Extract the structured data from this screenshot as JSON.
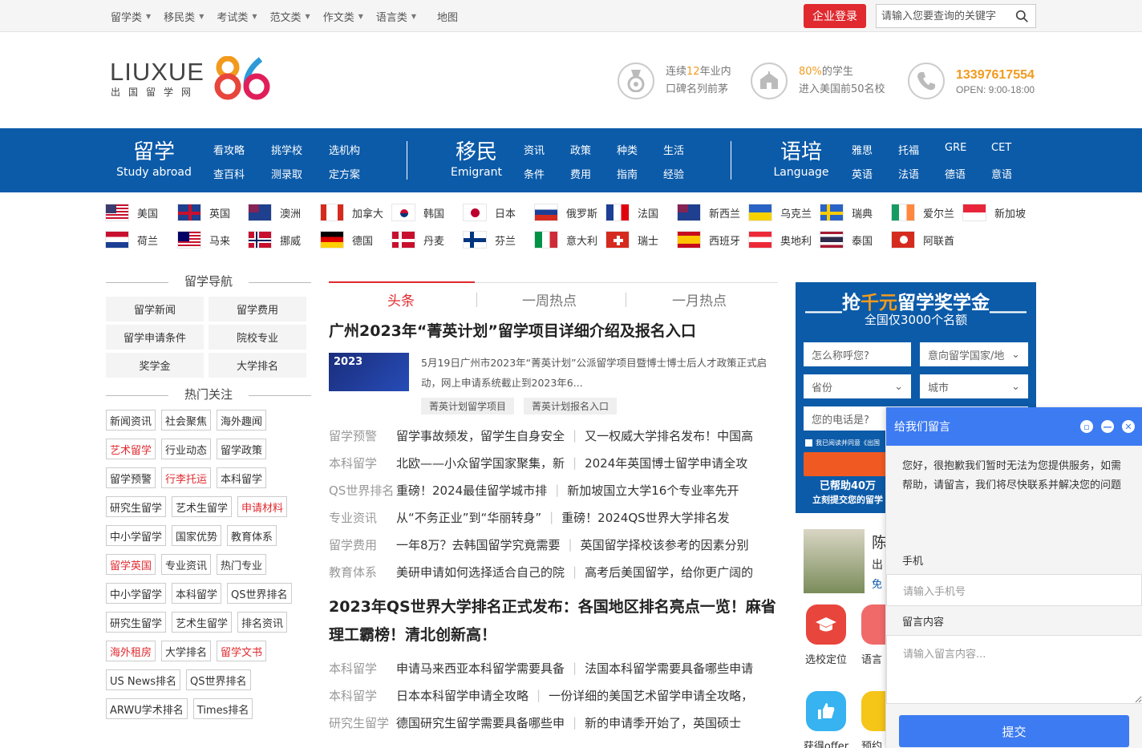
{
  "topnav": {
    "items": [
      "留学类",
      "移民类",
      "考试类",
      "范文类",
      "作文类",
      "语言类"
    ],
    "map": "地图",
    "login_button": "企业登录",
    "search_placeholder": "请输入您要查询的关键字"
  },
  "logo": {
    "word": "LIUXUE",
    "num": "86",
    "sub": "出国留学网"
  },
  "features": {
    "f1": {
      "a": "连续",
      "b": "12",
      "c": "年业内",
      "line2": "口碑名列前茅",
      "icon": "medal-icon"
    },
    "f2": {
      "b": "80%",
      "c": "的学生",
      "line2": "进入美国前50名校",
      "icon": "school-icon"
    },
    "f3": {
      "phone": "13397617554",
      "hours": "OPEN: 9:00-18:00",
      "icon": "phone-icon"
    }
  },
  "mainnav": {
    "study": {
      "cn": "留学",
      "en": "Study abroad",
      "links": [
        "看攻略",
        "挑学校",
        "选机构",
        "查百科",
        "测录取",
        "定方案"
      ]
    },
    "immigrant": {
      "cn": "移民",
      "en": "Emigrant",
      "links": [
        "资讯",
        "政策",
        "种类",
        "生活",
        "条件",
        "费用",
        "指南",
        "经验"
      ]
    },
    "language": {
      "cn": "语培",
      "en": "Language",
      "links": [
        "雅思",
        "托福",
        "GRE",
        "CET",
        "英语",
        "法语",
        "德语",
        "意语"
      ]
    }
  },
  "countries": {
    "row1": [
      "美国",
      "英国",
      "澳洲",
      "加拿大",
      "韩国",
      "日本",
      "俄罗斯",
      "法国",
      "新西兰",
      "乌克兰",
      "瑞典",
      "爱尔兰",
      "新加坡"
    ],
    "row2": [
      "荷兰",
      "马来",
      "挪威",
      "德国",
      "丹麦",
      "芬兰",
      "意大利",
      "瑞士",
      "西班牙",
      "奥地利",
      "泰国",
      "阿联酋"
    ]
  },
  "sidebar": {
    "nav_title": "留学导航",
    "nav_items": [
      "留学新闻",
      "留学费用",
      "留学申请条件",
      "院校专业",
      "奖学金",
      "大学排名"
    ],
    "hot_title": "热门关注",
    "tags": [
      "新闻资讯",
      "社会聚焦",
      "海外趣闻",
      "艺术留学",
      "行业动态",
      "留学政策",
      "留学预警",
      "行李托运",
      "本科留学",
      "研究生留学",
      "艺术生留学",
      "申请材料",
      "中小学留学",
      "国家优势",
      "教育体系",
      "留学英国",
      "专业资讯",
      "热门专业",
      "中小学留学",
      "本科留学",
      "QS世界排名",
      "研究生留学",
      "艺术生留学",
      "排名资讯",
      "海外租房",
      "大学排名",
      "留学文书",
      "US News排名",
      "QS世界排名",
      "ARWU学术排名",
      "Times排名"
    ],
    "red_tags": [
      3,
      7,
      11,
      15,
      24,
      26
    ]
  },
  "center": {
    "tabs": [
      "头条",
      "一周热点",
      "一月热点"
    ],
    "headline": "广州2023年“菁英计划”留学项目详细介绍及报名入口",
    "thumb_text": "2023",
    "desc": "5月19日广州市2023年“菁英计划”公派留学项目暨博士博士后人才政策正式启动，网上申请系统截止到2023年6...",
    "tags": [
      "菁英计划留学项目",
      "菁英计划报名入口"
    ],
    "news": [
      {
        "cat": "留学预警",
        "a": "留学事故频发，留学生自身安全",
        "b": "又一权威大学排名发布！中国高"
      },
      {
        "cat": "本科留学",
        "a": "北欧——小众留学国家聚集，新",
        "b": "2024年英国博士留学申请全攻"
      },
      {
        "cat": "QS世界排名",
        "a": "重磅！2024最佳留学城市排",
        "b": "新加坡国立大学16个专业率先开"
      },
      {
        "cat": "专业资讯",
        "a": "从“不务正业”到“华丽转身”",
        "b": "重磅！2024QS世界大学排名发"
      },
      {
        "cat": "留学费用",
        "a": "一年8万？去韩国留学究竟需要",
        "b": "英国留学择校该参考的因素分别"
      },
      {
        "cat": "教育体系",
        "a": "美研申请如何选择适合自己的院",
        "b": "高考后美国留学，给你更广阔的"
      }
    ],
    "headline2": "2023年QS世界大学排名正式发布：各国地区排名亮点一览！麻省理工霸榜！清北创新高！",
    "news2": [
      {
        "cat": "本科留学",
        "a": "申请马来西亚本科留学需要具备",
        "b": "法国本科留学需要具备哪些申请"
      },
      {
        "cat": "本科留学",
        "a": "日本本科留学申请全攻略",
        "b": "一份详细的美国艺术留学申请全攻略，"
      },
      {
        "cat": "研究生留学",
        "a": "德国研究生留学需要具备哪些申",
        "b": "新的申请季开始了，英国硕士"
      }
    ]
  },
  "promo": {
    "title_a": "抢",
    "title_b": "千元",
    "title_c": "留学奖学金",
    "subtitle": "全国仅3000个名额",
    "name_placeholder": "怎么称呼您?",
    "country_select": "意向留学国家/地",
    "province": "省份",
    "city": "城市",
    "phone_placeholder": "您的电话是?",
    "agree": "我已阅读并同意《出国",
    "helped_a": "已帮助40万",
    "helped_b": "立刻提交您的留学"
  },
  "profile": {
    "name": "陈",
    "l2": "出",
    "l3": "免"
  },
  "services": [
    {
      "label": "选校定位",
      "color": "#e8453c",
      "icon": "graduation-cap-icon"
    },
    {
      "label": "语言",
      "color": "#f06a6a",
      "icon": "microphone-icon"
    },
    {
      "label": "获得offer",
      "color": "#36b3f0",
      "icon": "thumbs-up-icon"
    },
    {
      "label": "预约",
      "color": "#f5c518",
      "icon": "vip-icon"
    }
  ],
  "chat": {
    "title": "给我们留言",
    "message": "您好，很抱歉我们暂时无法为您提供服务，如需帮助，请留言，我们将尽快联系并解决您的问题",
    "phone_label": "手机",
    "phone_placeholder": "请输入手机号",
    "content_label": "留言内容",
    "content_placeholder": "请输入留言内容...",
    "submit": "提交"
  }
}
